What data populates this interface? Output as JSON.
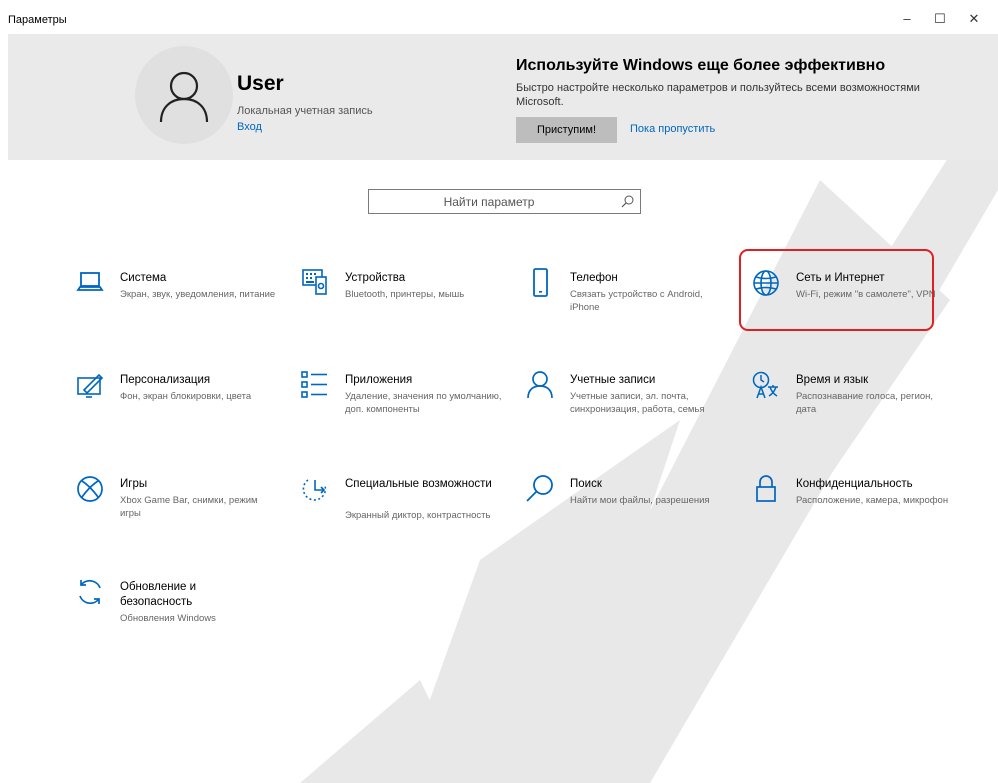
{
  "window": {
    "title": "Параметры",
    "minimize_symbol": "–",
    "maximize_symbol": "☐",
    "close_symbol": "✕"
  },
  "account": {
    "name": "User",
    "type": "Локальная учетная запись",
    "sign_in": "Вход"
  },
  "promo": {
    "title": "Используйте Windows еще более эффективно",
    "description": "Быстро настройте несколько параметров и пользуйтесь всеми возможностями Microsoft.",
    "primary_button": "Приступим!",
    "skip_link": "Пока пропустить"
  },
  "search": {
    "placeholder": "Найти параметр"
  },
  "accent_color": "#0067c0",
  "highlight_color": "#e02020",
  "categories": [
    {
      "icon": "laptop-icon",
      "title": "Система",
      "description": "Экран, звук, уведомления, питание"
    },
    {
      "icon": "keyboard-icon",
      "title": "Устройства",
      "description": "Bluetooth, принтеры, мышь"
    },
    {
      "icon": "phone-icon",
      "title": "Телефон",
      "description": "Связать устройство с Android, iPhone"
    },
    {
      "icon": "globe-icon",
      "title": "Сеть и Интернет",
      "description": "Wi-Fi, режим \"в самолете\", VPN"
    },
    {
      "icon": "paint-icon",
      "title": "Персонализация",
      "description": "Фон, экран блокировки, цвета"
    },
    {
      "icon": "apps-list-icon",
      "title": "Приложения",
      "description": "Удаление, значения по умолчанию, доп. компоненты"
    },
    {
      "icon": "person-icon",
      "title": "Учетные записи",
      "description": "Учетные записи, эл. почта, синхронизация, работа, семья"
    },
    {
      "icon": "language-time-icon",
      "title": "Время и язык",
      "description": "Распознавание голоса, регион, дата"
    },
    {
      "icon": "xbox-icon",
      "title": "Игры",
      "description": "Xbox Game Bar, снимки, режим игры"
    },
    {
      "icon": "accessibility-icon",
      "title": "Специальные возможности",
      "description": "Экранный диктор, контрастность"
    },
    {
      "icon": "search-icon",
      "title": "Поиск",
      "description": "Найти мои файлы, разрешения"
    },
    {
      "icon": "lock-icon",
      "title": "Конфиденциальность",
      "description": "Расположение, камера, микрофон"
    },
    {
      "icon": "update-icon",
      "title": "Обновление и безопасность",
      "description": "Обновления Windows"
    }
  ]
}
